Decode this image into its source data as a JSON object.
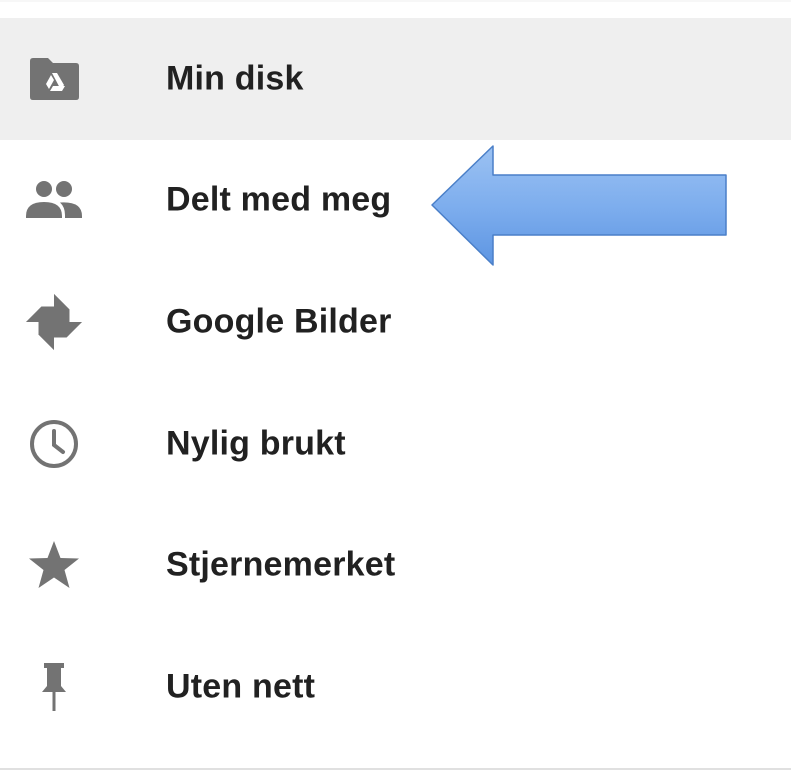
{
  "nav": {
    "items": [
      {
        "label": "Min disk",
        "icon": "drive-folder-icon",
        "active": true
      },
      {
        "label": "Delt med meg",
        "icon": "shared-people-icon",
        "active": false
      },
      {
        "label": "Google Bilder",
        "icon": "google-photos-icon",
        "active": false
      },
      {
        "label": "Nylig brukt",
        "icon": "clock-icon",
        "active": false
      },
      {
        "label": "Stjernemerket",
        "icon": "star-icon",
        "active": false
      },
      {
        "label": "Uten nett",
        "icon": "pin-icon",
        "active": false
      }
    ]
  },
  "annotation": {
    "arrow_direction": "left",
    "arrow_color": "#6fa3e8",
    "points_to": "Delt med meg"
  },
  "colors": {
    "active_row_bg": "#efefef",
    "icon_gray": "#737373",
    "label_text": "#212121"
  }
}
